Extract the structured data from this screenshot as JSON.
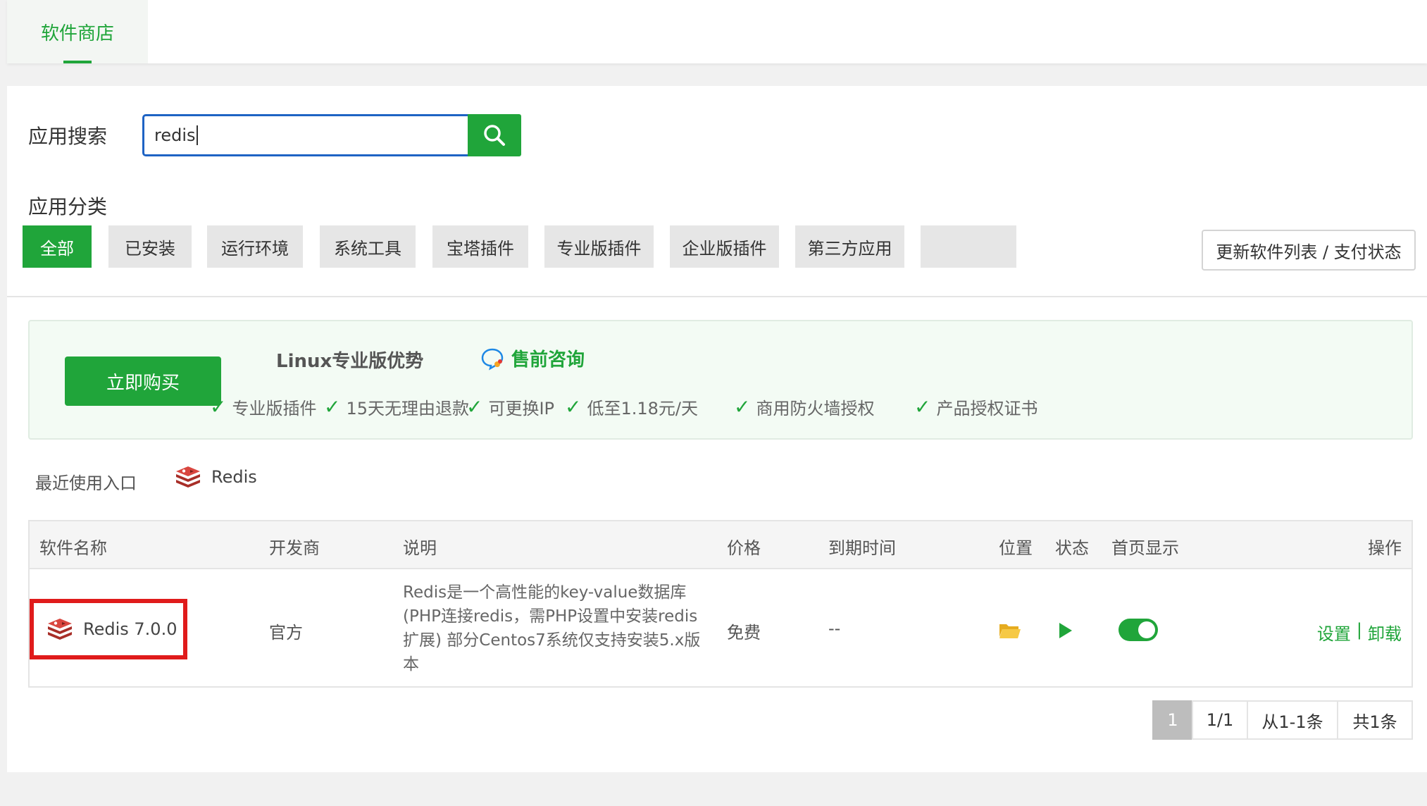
{
  "top_tabs": [
    {
      "label": "软件商店",
      "active": true
    }
  ],
  "search": {
    "label": "应用搜索",
    "value": "redis"
  },
  "category": {
    "label": "应用分类",
    "items": [
      {
        "label": "全部",
        "active": true
      },
      {
        "label": "已安装"
      },
      {
        "label": "运行环境"
      },
      {
        "label": "系统工具"
      },
      {
        "label": "宝塔插件"
      },
      {
        "label": "专业版插件"
      },
      {
        "label": "企业版插件"
      },
      {
        "label": "第三方应用"
      }
    ],
    "update_button": "更新软件列表 / 支付状态"
  },
  "promo": {
    "buy_button": "立即购买",
    "title": "Linux专业版优势",
    "consult": "售前咨询",
    "features": [
      "专业版插件",
      "15天无理由退款",
      "可更换IP",
      "低至1.18元/天",
      "商用防火墙授权",
      "产品授权证书"
    ]
  },
  "recent": {
    "label": "最近使用入口",
    "items": [
      "Redis"
    ]
  },
  "table": {
    "headers": [
      "软件名称",
      "开发商",
      "说明",
      "价格",
      "到期时间",
      "位置",
      "状态",
      "首页显示",
      "操作"
    ],
    "rows": [
      {
        "name": "Redis 7.0.0",
        "developer": "官方",
        "description_lines": [
          "Redis是一个高性能的key-value数据库",
          "(PHP连接redis，需PHP设置中安装redis",
          "扩展) 部分Centos7系统仅支持安装5.x版",
          "本"
        ],
        "price": "免费",
        "expire": "--",
        "location_icon": "folder-icon",
        "status_icon": "play-icon",
        "homepage_display": true,
        "actions": [
          "设置",
          "卸载"
        ],
        "action_separator": "|"
      }
    ]
  },
  "pagination": {
    "current": "1",
    "pages": "1/1",
    "range": "从1-1条",
    "total": "共1条"
  },
  "colors": {
    "accent": "#20a53a",
    "highlight": "#e01b1b",
    "search_border": "#1e63c4",
    "redis": "#c6302b"
  }
}
